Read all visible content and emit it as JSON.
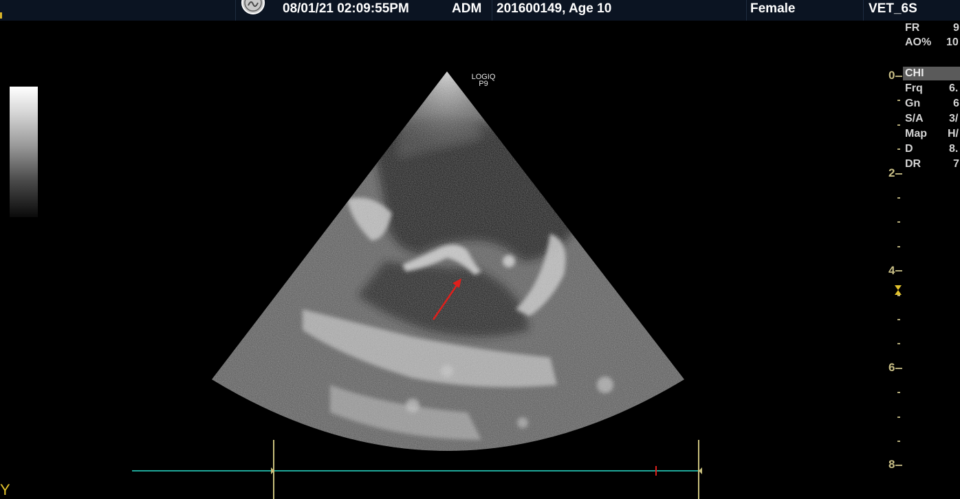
{
  "header": {
    "datetime": "08/01/21 02:09:55PM",
    "operator": "ADM",
    "patient": "201600149, Age 10",
    "sex": "Female",
    "preset": "VET_6S"
  },
  "probe": {
    "line1": "LOGIQ",
    "line2": "P9"
  },
  "acquisition": [
    {
      "label": "FR",
      "value": "9"
    },
    {
      "label": "AO%",
      "value": "10"
    }
  ],
  "mode": {
    "label": "CHI"
  },
  "imaging_params": [
    {
      "label": "Frq",
      "value": "6."
    },
    {
      "label": "Gn",
      "value": "6"
    },
    {
      "label": "S/A",
      "value": "3/"
    },
    {
      "label": "Map",
      "value": "H/"
    },
    {
      "label": "D",
      "value": "8."
    },
    {
      "label": "DR",
      "value": "7"
    }
  ],
  "depth_scale": {
    "unit_labels": [
      "0",
      "2",
      "4",
      "6",
      "8"
    ],
    "focus_depth_cm": 4.4
  },
  "corner_text": "Y",
  "annotation": {
    "type": "arrow",
    "color": "#e0201c"
  },
  "colors": {
    "header_bg": "#0b1422",
    "param_text": "#d4d4d4",
    "depth_text": "#c9bf86",
    "timeline_line": "#1fa89a",
    "marker_yellow": "#e3c32c",
    "arrow_red": "#e0201c"
  },
  "icons": [
    "ge-logo-icon",
    "focus-marker-icon",
    "arrow-annotation-icon"
  ]
}
